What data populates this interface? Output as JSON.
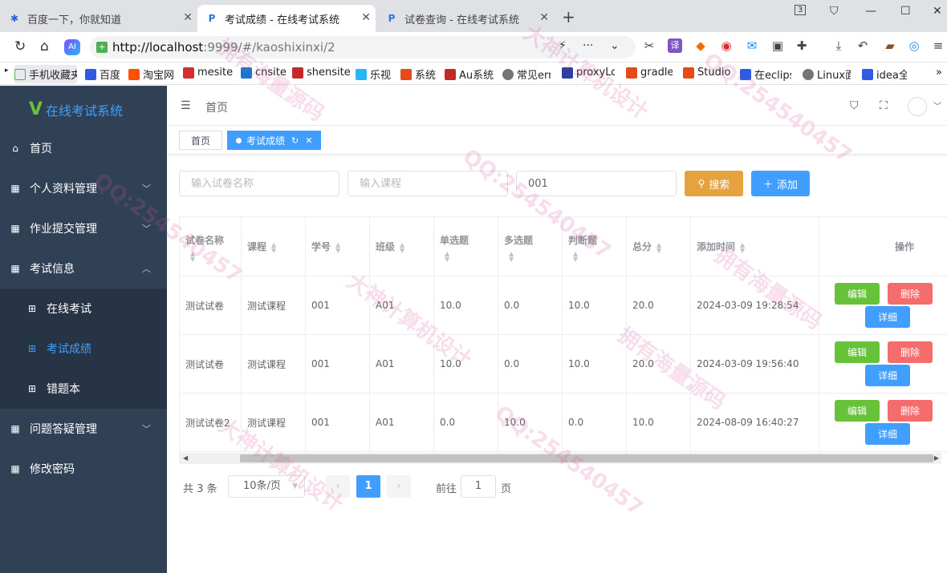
{
  "browser": {
    "tabs": [
      {
        "label": "百度一下，你就知道"
      },
      {
        "label": "考试成绩 - 在线考试系统"
      },
      {
        "label": "试卷查询 - 在线考试系统"
      }
    ],
    "tab_counter": "3",
    "url_host": "http://localhost",
    "url_rest": ":9999/#/kaoshixinxi/2",
    "bookmarks": [
      {
        "label": "手机收藏夹",
        "color": "#4caf50"
      },
      {
        "label": "百度",
        "color": "#2d5be3"
      },
      {
        "label": "淘宝网",
        "color": "#ff5000"
      },
      {
        "label": "mesite",
        "color": "#d32f2f"
      },
      {
        "label": "cnsite",
        "color": "#1976d2"
      },
      {
        "label": "shensite",
        "color": "#c62828"
      },
      {
        "label": "乐视",
        "color": "#29b6f6"
      },
      {
        "label": "系统",
        "color": "#e64a19"
      },
      {
        "label": "Au系统",
        "color": "#c62828"
      },
      {
        "label": "常见err",
        "color": "#757575"
      },
      {
        "label": "proxyLo",
        "color": "#303f9f"
      },
      {
        "label": "gradle",
        "color": "#e64a19"
      },
      {
        "label": "Studio",
        "color": "#e64a19"
      },
      {
        "label": "在eclips",
        "color": "#2d5be3"
      },
      {
        "label": "Linux面",
        "color": "#757575"
      },
      {
        "label": "idea全",
        "color": "#2d5be3"
      }
    ]
  },
  "app": {
    "logo_text": "在线考试系统",
    "breadcrumb": "首页",
    "menu": [
      {
        "label": "首页",
        "icon": "home-icon"
      },
      {
        "label": "个人资料管理",
        "icon": "grid-icon"
      },
      {
        "label": "作业提交管理",
        "icon": "grid-icon"
      },
      {
        "label": "考试信息",
        "icon": "grid-icon"
      },
      {
        "label": "在线考试",
        "icon": "apps-icon"
      },
      {
        "label": "考试成绩",
        "icon": "apps-icon"
      },
      {
        "label": "错题本",
        "icon": "apps-icon"
      },
      {
        "label": "问题答疑管理",
        "icon": "grid-icon"
      },
      {
        "label": "修改密码",
        "icon": "grid-icon"
      }
    ],
    "tags": [
      {
        "label": "首页"
      },
      {
        "label": "考试成绩"
      }
    ]
  },
  "search": {
    "paper_placeholder": "输入试卷名称",
    "course_placeholder": "输入课程",
    "student_value": "001",
    "search_label": "搜索",
    "add_label": "添加"
  },
  "table": {
    "columns": [
      "试卷名称",
      "课程",
      "学号",
      "班级",
      "单选题",
      "多选题",
      "判断题",
      "总分",
      "添加时间",
      "操作"
    ],
    "rows": [
      [
        "测试试卷",
        "测试课程",
        "001",
        "A01",
        "10.0",
        "0.0",
        "10.0",
        "20.0",
        "2024-03-09 19:28:54"
      ],
      [
        "测试试卷",
        "测试课程",
        "001",
        "A01",
        "10.0",
        "0.0",
        "10.0",
        "20.0",
        "2024-03-09 19:56:40"
      ],
      [
        "测试试卷2",
        "测试课程",
        "001",
        "A01",
        "0.0",
        "10.0",
        "0.0",
        "10.0",
        "2024-08-09 16:40:27"
      ]
    ],
    "actions": {
      "edit": "编辑",
      "delete": "删除",
      "detail": "详细"
    }
  },
  "pagination": {
    "total": "共 3 条",
    "page_size": "10条/页",
    "current": "1",
    "goto": "前往",
    "goto_value": "1",
    "unit": "页"
  },
  "watermarks": [
    "大神计算机设计",
    "拥有海量源码",
    "QQ:254540457"
  ]
}
